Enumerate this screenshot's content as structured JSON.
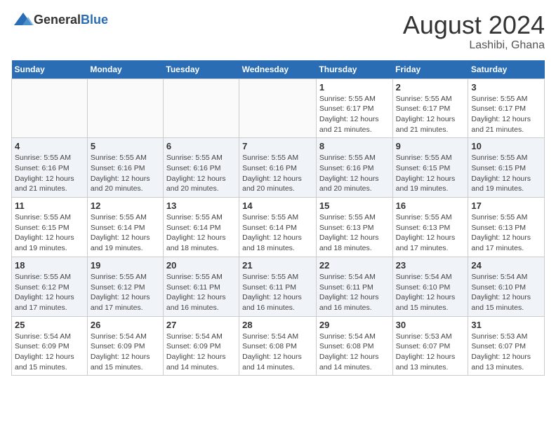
{
  "logo": {
    "text_general": "General",
    "text_blue": "Blue"
  },
  "title": "August 2024",
  "subtitle": "Lashibi, Ghana",
  "weekdays": [
    "Sunday",
    "Monday",
    "Tuesday",
    "Wednesday",
    "Thursday",
    "Friday",
    "Saturday"
  ],
  "weeks": [
    [
      {
        "day": "",
        "info": ""
      },
      {
        "day": "",
        "info": ""
      },
      {
        "day": "",
        "info": ""
      },
      {
        "day": "",
        "info": ""
      },
      {
        "day": "1",
        "info": "Sunrise: 5:55 AM\nSunset: 6:17 PM\nDaylight: 12 hours\nand 21 minutes."
      },
      {
        "day": "2",
        "info": "Sunrise: 5:55 AM\nSunset: 6:17 PM\nDaylight: 12 hours\nand 21 minutes."
      },
      {
        "day": "3",
        "info": "Sunrise: 5:55 AM\nSunset: 6:17 PM\nDaylight: 12 hours\nand 21 minutes."
      }
    ],
    [
      {
        "day": "4",
        "info": "Sunrise: 5:55 AM\nSunset: 6:16 PM\nDaylight: 12 hours\nand 21 minutes."
      },
      {
        "day": "5",
        "info": "Sunrise: 5:55 AM\nSunset: 6:16 PM\nDaylight: 12 hours\nand 20 minutes."
      },
      {
        "day": "6",
        "info": "Sunrise: 5:55 AM\nSunset: 6:16 PM\nDaylight: 12 hours\nand 20 minutes."
      },
      {
        "day": "7",
        "info": "Sunrise: 5:55 AM\nSunset: 6:16 PM\nDaylight: 12 hours\nand 20 minutes."
      },
      {
        "day": "8",
        "info": "Sunrise: 5:55 AM\nSunset: 6:16 PM\nDaylight: 12 hours\nand 20 minutes."
      },
      {
        "day": "9",
        "info": "Sunrise: 5:55 AM\nSunset: 6:15 PM\nDaylight: 12 hours\nand 19 minutes."
      },
      {
        "day": "10",
        "info": "Sunrise: 5:55 AM\nSunset: 6:15 PM\nDaylight: 12 hours\nand 19 minutes."
      }
    ],
    [
      {
        "day": "11",
        "info": "Sunrise: 5:55 AM\nSunset: 6:15 PM\nDaylight: 12 hours\nand 19 minutes."
      },
      {
        "day": "12",
        "info": "Sunrise: 5:55 AM\nSunset: 6:14 PM\nDaylight: 12 hours\nand 19 minutes."
      },
      {
        "day": "13",
        "info": "Sunrise: 5:55 AM\nSunset: 6:14 PM\nDaylight: 12 hours\nand 18 minutes."
      },
      {
        "day": "14",
        "info": "Sunrise: 5:55 AM\nSunset: 6:14 PM\nDaylight: 12 hours\nand 18 minutes."
      },
      {
        "day": "15",
        "info": "Sunrise: 5:55 AM\nSunset: 6:13 PM\nDaylight: 12 hours\nand 18 minutes."
      },
      {
        "day": "16",
        "info": "Sunrise: 5:55 AM\nSunset: 6:13 PM\nDaylight: 12 hours\nand 17 minutes."
      },
      {
        "day": "17",
        "info": "Sunrise: 5:55 AM\nSunset: 6:13 PM\nDaylight: 12 hours\nand 17 minutes."
      }
    ],
    [
      {
        "day": "18",
        "info": "Sunrise: 5:55 AM\nSunset: 6:12 PM\nDaylight: 12 hours\nand 17 minutes."
      },
      {
        "day": "19",
        "info": "Sunrise: 5:55 AM\nSunset: 6:12 PM\nDaylight: 12 hours\nand 17 minutes."
      },
      {
        "day": "20",
        "info": "Sunrise: 5:55 AM\nSunset: 6:11 PM\nDaylight: 12 hours\nand 16 minutes."
      },
      {
        "day": "21",
        "info": "Sunrise: 5:55 AM\nSunset: 6:11 PM\nDaylight: 12 hours\nand 16 minutes."
      },
      {
        "day": "22",
        "info": "Sunrise: 5:54 AM\nSunset: 6:11 PM\nDaylight: 12 hours\nand 16 minutes."
      },
      {
        "day": "23",
        "info": "Sunrise: 5:54 AM\nSunset: 6:10 PM\nDaylight: 12 hours\nand 15 minutes."
      },
      {
        "day": "24",
        "info": "Sunrise: 5:54 AM\nSunset: 6:10 PM\nDaylight: 12 hours\nand 15 minutes."
      }
    ],
    [
      {
        "day": "25",
        "info": "Sunrise: 5:54 AM\nSunset: 6:09 PM\nDaylight: 12 hours\nand 15 minutes."
      },
      {
        "day": "26",
        "info": "Sunrise: 5:54 AM\nSunset: 6:09 PM\nDaylight: 12 hours\nand 15 minutes."
      },
      {
        "day": "27",
        "info": "Sunrise: 5:54 AM\nSunset: 6:09 PM\nDaylight: 12 hours\nand 14 minutes."
      },
      {
        "day": "28",
        "info": "Sunrise: 5:54 AM\nSunset: 6:08 PM\nDaylight: 12 hours\nand 14 minutes."
      },
      {
        "day": "29",
        "info": "Sunrise: 5:54 AM\nSunset: 6:08 PM\nDaylight: 12 hours\nand 14 minutes."
      },
      {
        "day": "30",
        "info": "Sunrise: 5:53 AM\nSunset: 6:07 PM\nDaylight: 12 hours\nand 13 minutes."
      },
      {
        "day": "31",
        "info": "Sunrise: 5:53 AM\nSunset: 6:07 PM\nDaylight: 12 hours\nand 13 minutes."
      }
    ]
  ]
}
